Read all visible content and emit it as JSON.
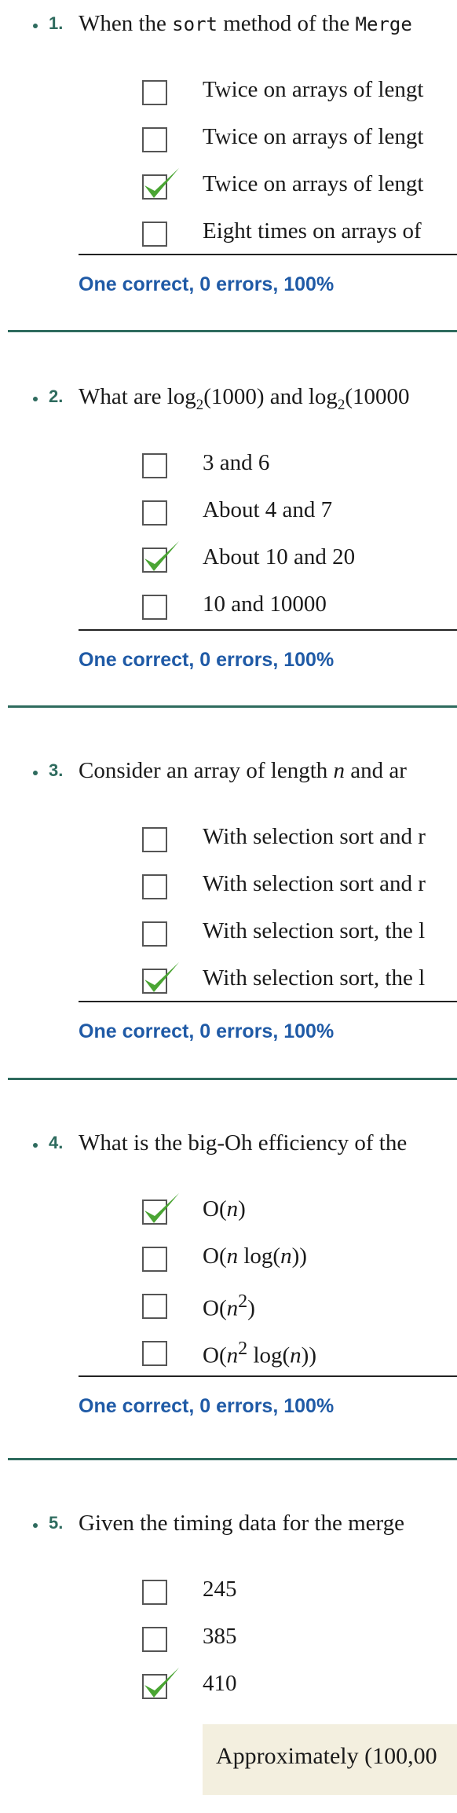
{
  "questions": [
    {
      "number": "1.",
      "prompt_pre": "When the ",
      "prompt_code1": "sort",
      "prompt_mid": " method of the ",
      "prompt_code2": "Merge",
      "options": [
        {
          "text": "Twice on arrays of lengt",
          "checked": false
        },
        {
          "text": "Twice on arrays of lengt",
          "checked": false
        },
        {
          "text": "Twice on arrays of lengt",
          "checked": true
        },
        {
          "text": "Eight times on arrays of",
          "checked": false
        }
      ],
      "score": "One correct, 0 errors, 100%"
    },
    {
      "number": "2.",
      "prompt_a": "What are log",
      "prompt_sub1": "2",
      "prompt_b": "(1000) and log",
      "prompt_sub2": "2",
      "prompt_c": "(10000",
      "options": [
        {
          "text": "3 and 6",
          "checked": false
        },
        {
          "text": "About 4 and 7",
          "checked": false
        },
        {
          "text": "About 10 and 20",
          "checked": true
        },
        {
          "text": "10 and 10000",
          "checked": false
        }
      ],
      "score": "One correct, 0 errors, 100%"
    },
    {
      "number": "3.",
      "prompt_a": "Consider an array of length ",
      "prompt_var": "n",
      "prompt_b": " and ar",
      "options": [
        {
          "text": "With selection sort and r",
          "checked": false
        },
        {
          "text": "With selection sort and r",
          "checked": false
        },
        {
          "text": "With selection sort, the l",
          "checked": false
        },
        {
          "text": "With selection sort, the l",
          "checked": true
        }
      ],
      "score": "One correct, 0 errors, 100%"
    },
    {
      "number": "4.",
      "prompt": "What is the big-Oh efficiency of the",
      "options": [
        {
          "text": "O(n)",
          "checked": true
        },
        {
          "text": "O(n log(n))",
          "checked": false
        },
        {
          "text": "O(n2)",
          "checked": false
        },
        {
          "text": "O(n2 log(n))",
          "checked": false
        }
      ],
      "score": "One correct, 0 errors, 100%"
    },
    {
      "number": "5.",
      "prompt": "Given the timing data for the merge",
      "options": [
        {
          "text": "245",
          "checked": false
        },
        {
          "text": "385",
          "checked": false
        },
        {
          "text": "410",
          "checked": true
        }
      ],
      "explanation": "Approximately (100,00"
    }
  ]
}
